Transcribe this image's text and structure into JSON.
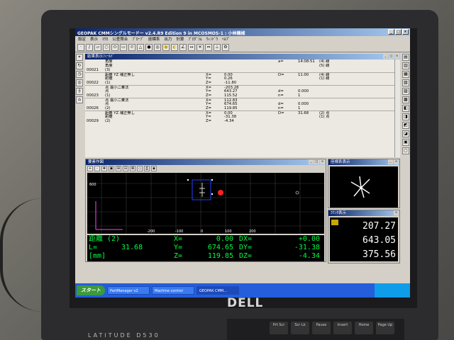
{
  "window": {
    "title": "GEOPAK CMMシングルモードー v2.4.R9 Edition 9 in MCOSMOS-1 : 小林機械"
  },
  "menu": [
    "設定",
    "表示",
    "ﾏｸﾛ",
    "公差照合",
    "ﾌﾟﾛｰﾌﾞ",
    "座標系",
    "出力",
    "計算",
    "ﾌﾟﾛｸﾞﾗﾑ",
    "ｳｨﾝﾄﾞｳ",
    "ﾍﾙﾌﾟ"
  ],
  "result_panel": {
    "title": "結果表示ﾌｨｰﾙﾄﾞ",
    "rows": [
      {
        "id": "",
        "name": "角度",
        "c1": "",
        "v1": "",
        "c2": "a=",
        "v2": "14:08:51",
        "v3": "(4) 線"
      },
      {
        "id": "",
        "name": "角度",
        "c1": "",
        "v1": "",
        "c2": "",
        "v2": "",
        "v3": "(5) 線"
      },
      {
        "id": "00021",
        "name": "(3)",
        "c1": "",
        "v1": "",
        "c2": "",
        "v2": "",
        "v3": ""
      },
      {
        "id": "",
        "name": "距離 YZ 補正無し",
        "c1": "X=",
        "v1": "0.00",
        "c2": "D=",
        "v2": "11.00",
        "v3": "(4) 線"
      },
      {
        "id": "",
        "name": "距離",
        "c1": "Y=",
        "v1": "0.26",
        "c2": "",
        "v2": "",
        "v3": "(1) 線"
      },
      {
        "id": "00022",
        "name": "(1)",
        "c1": "Z=",
        "v1": "-11.80",
        "c2": "",
        "v2": "",
        "v3": ""
      },
      {
        "id": "",
        "name": "点 最小二乗法",
        "c1": "X=",
        "v1": "-203.28",
        "c2": "",
        "v2": "",
        "v3": ""
      },
      {
        "id": "",
        "name": "点",
        "c1": "Y=",
        "v1": "643.27",
        "c2": "d=",
        "v2": "0.000",
        "v3": ""
      },
      {
        "id": "00023",
        "name": "(1)",
        "c1": "Z=",
        "v1": "115.52",
        "c2": "n=",
        "v2": "1",
        "v3": ""
      },
      {
        "id": "",
        "name": "点 最小二乗法",
        "c1": "X=",
        "v1": "112.83",
        "c2": "",
        "v2": "",
        "v3": ""
      },
      {
        "id": "",
        "name": "点",
        "c1": "Y=",
        "v1": "674.65",
        "c2": "d=",
        "v2": "0.000",
        "v3": ""
      },
      {
        "id": "00026",
        "name": "(2)",
        "c1": "Z=",
        "v1": "119.85",
        "c2": "n=",
        "v2": "1",
        "v3": ""
      },
      {
        "id": "",
        "name": "距離 YZ 補正無し",
        "c1": "X=",
        "v1": "0.00",
        "c2": "D=",
        "v2": "31.68",
        "v3": "(2) 点"
      },
      {
        "id": "",
        "name": "距離",
        "c1": "Y=",
        "v1": "-31.38",
        "c2": "",
        "v2": "",
        "v3": "(1) 点"
      },
      {
        "id": "00029",
        "name": "(2)",
        "c1": "Z=",
        "v1": "-4.34",
        "c2": "",
        "v2": "",
        "v3": ""
      }
    ]
  },
  "graphics_panel": {
    "title": "要素作図",
    "axis_label": "600",
    "x_ticks": [
      "-200",
      "-100",
      "0",
      "100",
      "200"
    ],
    "readout": {
      "element": "距離 (2)",
      "l_label": "L=",
      "l_value": "31.68",
      "unit": "[mm]",
      "x_label": "X=",
      "x_value": "0.00",
      "y_label": "Y=",
      "y_value": "674.65",
      "z_label": "Z=",
      "z_value": "119.85",
      "dx_label": "DX=",
      "dx_value": "+0.00",
      "dy_label": "DY=",
      "dy_value": "-31.38",
      "dz_label": "DZ=",
      "dz_value": "-4.34"
    }
  },
  "coord_panel": {
    "title": "座標系表示"
  },
  "counter_panel": {
    "title": "ｶｳﾝﾀ表示",
    "x": "207.27",
    "y": "643.05",
    "z": "375.56"
  },
  "taskbar": {
    "start_label": "スタート",
    "items": [
      "PartManager v2",
      "Machine control",
      "GEOPAK CMM..."
    ]
  },
  "hardware": {
    "brand": "DELL",
    "model": "LATITUDE D530",
    "keys": [
      "Prt Scr",
      "Scr Lk",
      "Pause",
      "Insert",
      "Home",
      "Page Up"
    ]
  },
  "colors": {
    "readout_text": "#00ff40",
    "titlebar_start": "#0a246a",
    "target_point": "#ff2020",
    "selection_box": "#2040ff"
  }
}
